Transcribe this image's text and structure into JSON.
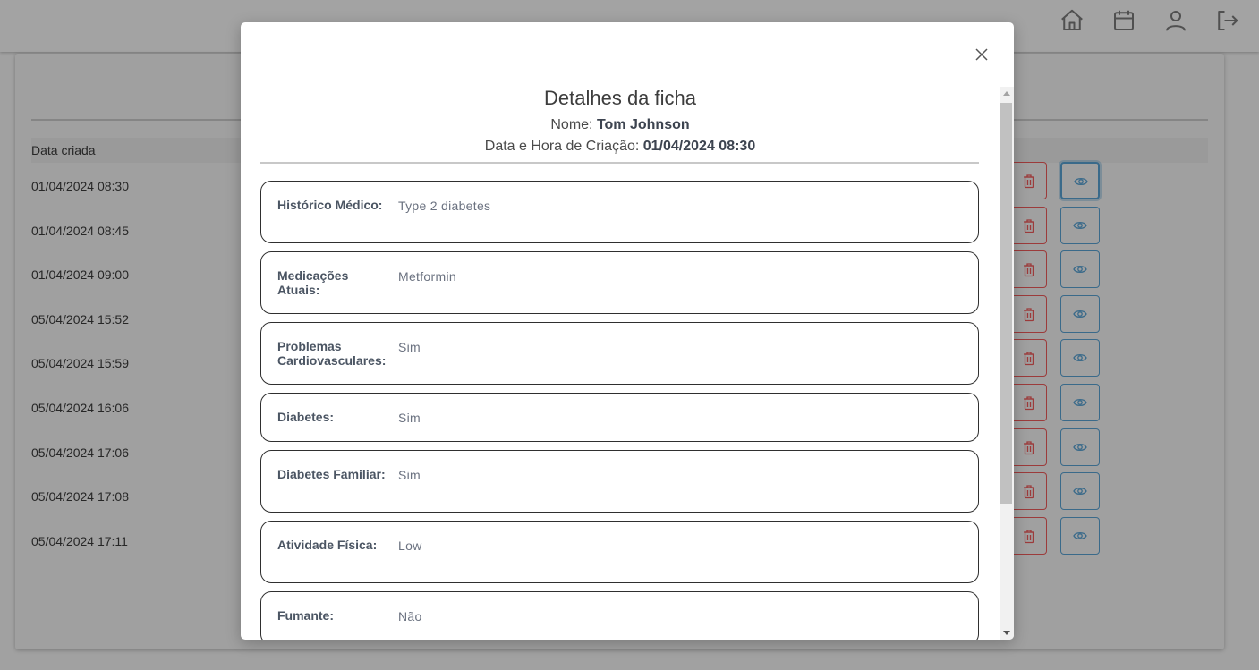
{
  "nav": {
    "icons": [
      "home-icon",
      "calendar-icon",
      "user-icon",
      "logout-icon"
    ]
  },
  "table": {
    "header_date": "Data criada",
    "rows": [
      "01/04/2024 08:30",
      "01/04/2024 08:45",
      "01/04/2024 09:00",
      "05/04/2024 15:52",
      "05/04/2024 15:59",
      "05/04/2024 16:06",
      "05/04/2024 17:06",
      "05/04/2024 17:08",
      "05/04/2024 17:11"
    ],
    "row_actions": [
      "trash-icon",
      "eye-icon"
    ]
  },
  "modal": {
    "title": "Detalhes da ficha",
    "name_label": "Nome:",
    "name_value": "Tom Johnson",
    "created_label": "Data e Hora de Criação:",
    "created_value": "01/04/2024 08:30",
    "fields": [
      {
        "label": "Histórico Médico:",
        "value": "Type 2 diabetes"
      },
      {
        "label": "Medicações Atuais:",
        "value": "Metformin"
      },
      {
        "label": "Problemas Cardiovasculares:",
        "value": "Sim"
      },
      {
        "label": "Diabetes:",
        "value": "Sim"
      },
      {
        "label": "Diabetes Familiar:",
        "value": "Sim"
      },
      {
        "label": "Atividade Física:",
        "value": "Low"
      },
      {
        "label": "Fumante:",
        "value": "Não"
      }
    ]
  },
  "colors": {
    "overlay": "#a1a1a1",
    "delete_border": "#9c3b3b",
    "view_border": "#3a6a8a",
    "card_border": "#2f2f2f"
  }
}
